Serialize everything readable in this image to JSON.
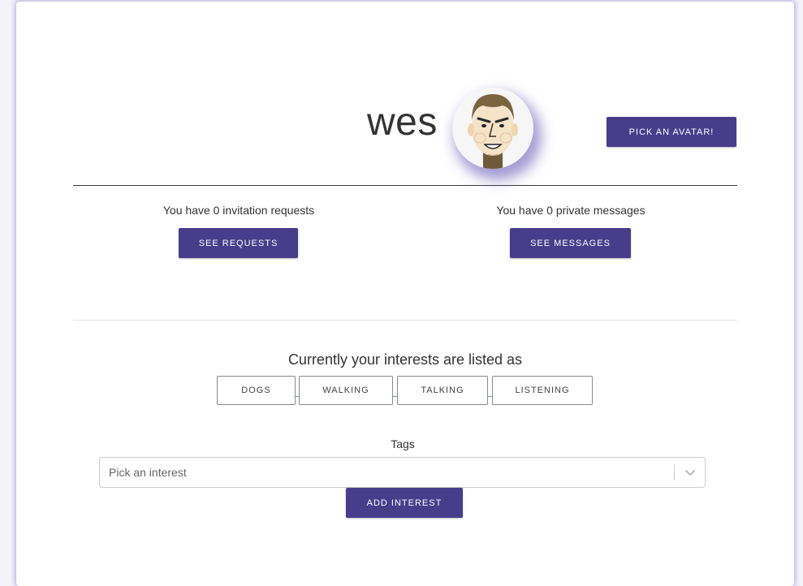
{
  "profile": {
    "username": "wes",
    "pick_avatar_label": "PICK AN AVATAR!"
  },
  "invitations": {
    "text": "You have 0 invitation requests",
    "button_label": "SEE REQUESTS"
  },
  "messages": {
    "text": "You have 0 private messages",
    "button_label": "SEE MESSAGES"
  },
  "interests": {
    "heading": "Currently your interests are listed as",
    "items": [
      "DOGS",
      "WALKING",
      "TALKING",
      "LISTENING"
    ]
  },
  "tags": {
    "label": "Tags",
    "placeholder": "Pick an interest",
    "add_label": "ADD INTEREST"
  },
  "colors": {
    "accent": "#483d8b",
    "card_shadow": "#786ebe"
  },
  "icons": {
    "dropdown": "chevron-down-icon",
    "avatar": "cartoon-face-avatar"
  }
}
